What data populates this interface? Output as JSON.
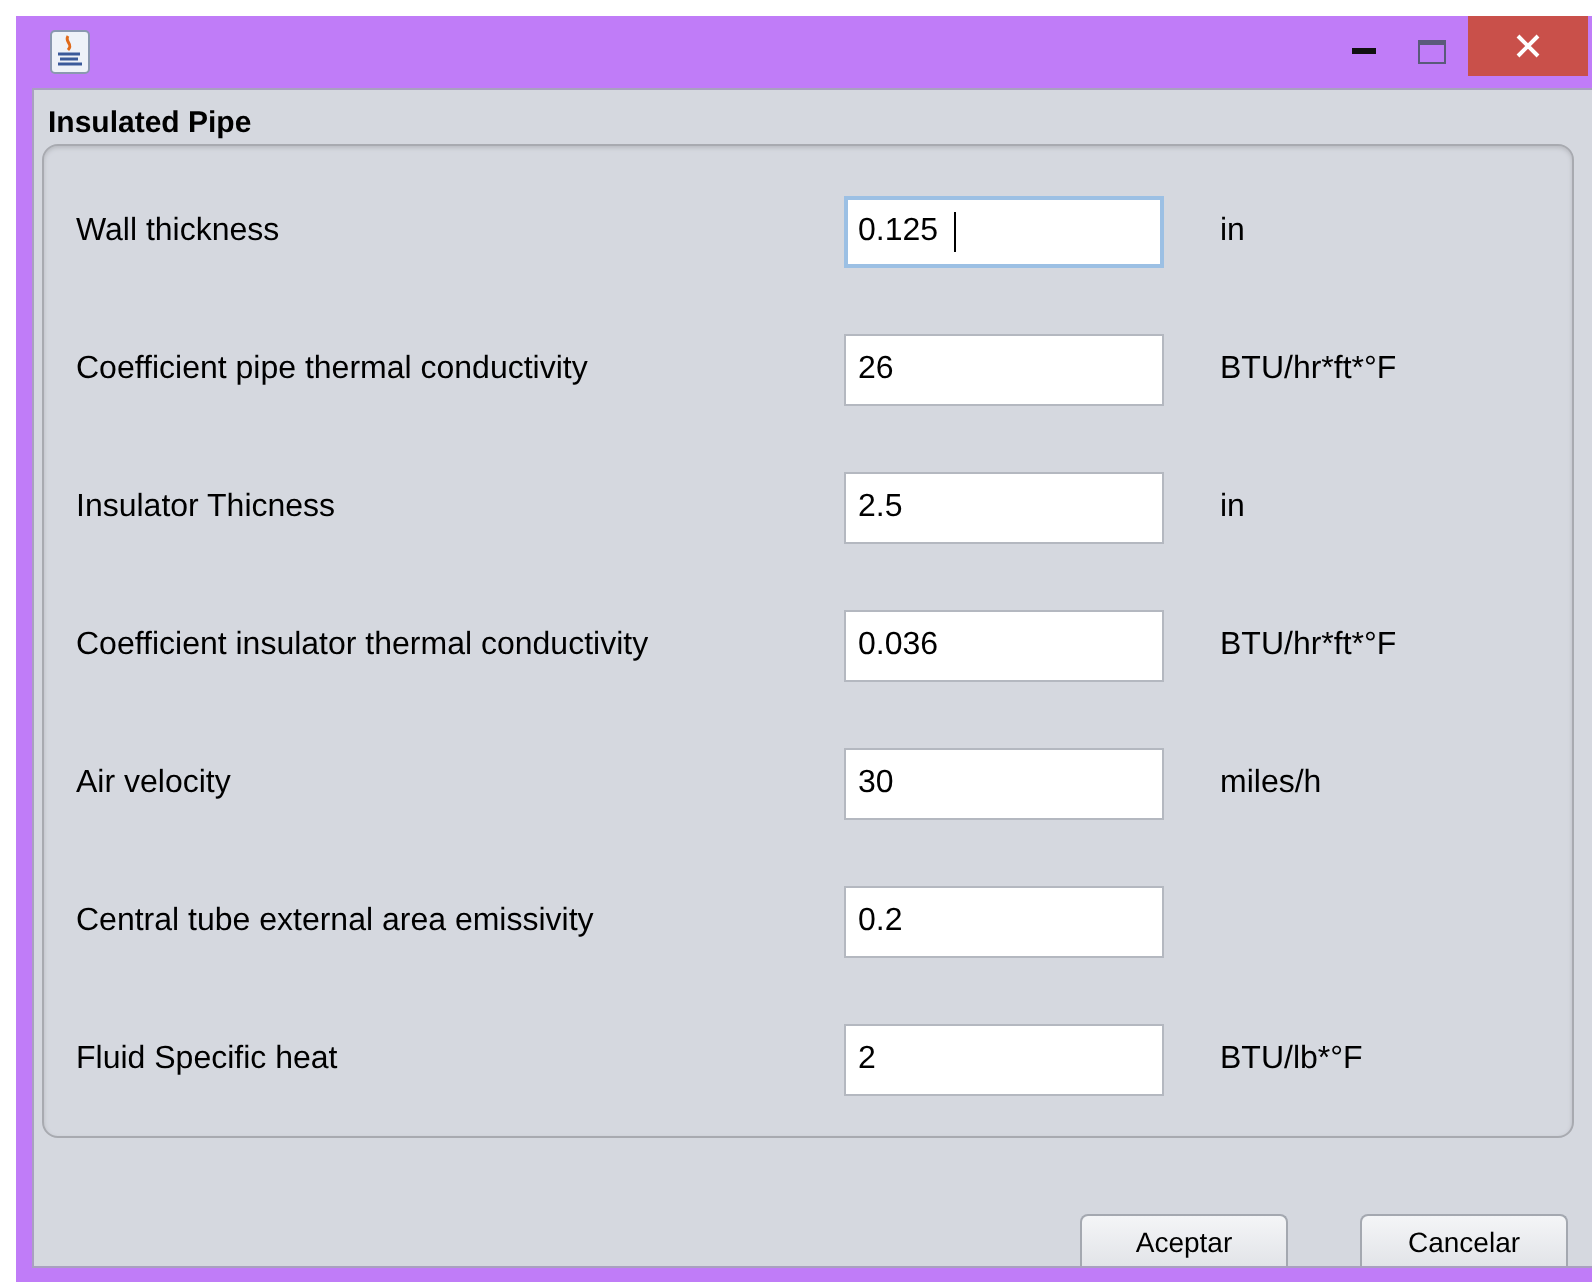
{
  "panel": {
    "title": "Insulated Pipe"
  },
  "fields": [
    {
      "label": "Wall thickness",
      "value": "0.125",
      "unit": "in",
      "focused": true
    },
    {
      "label": "Coefficient pipe thermal conductivity",
      "value": "26",
      "unit": "BTU/hr*ft*°F",
      "focused": false
    },
    {
      "label": "Insulator Thicness",
      "value": "2.5",
      "unit": "in",
      "focused": false
    },
    {
      "label": "Coefficient insulator thermal conductivity",
      "value": "0.036",
      "unit": "BTU/hr*ft*°F",
      "focused": false
    },
    {
      "label": "Air velocity",
      "value": "30",
      "unit": "miles/h",
      "focused": false
    },
    {
      "label": "Central tube external area emissivity",
      "value": "0.2",
      "focused": false
    },
    {
      "label": "Fluid Specific heat",
      "value": "2",
      "unit": "BTU/lb*°F",
      "focused": false
    }
  ],
  "buttons": [
    "Aceptar",
    "Cancelar"
  ]
}
